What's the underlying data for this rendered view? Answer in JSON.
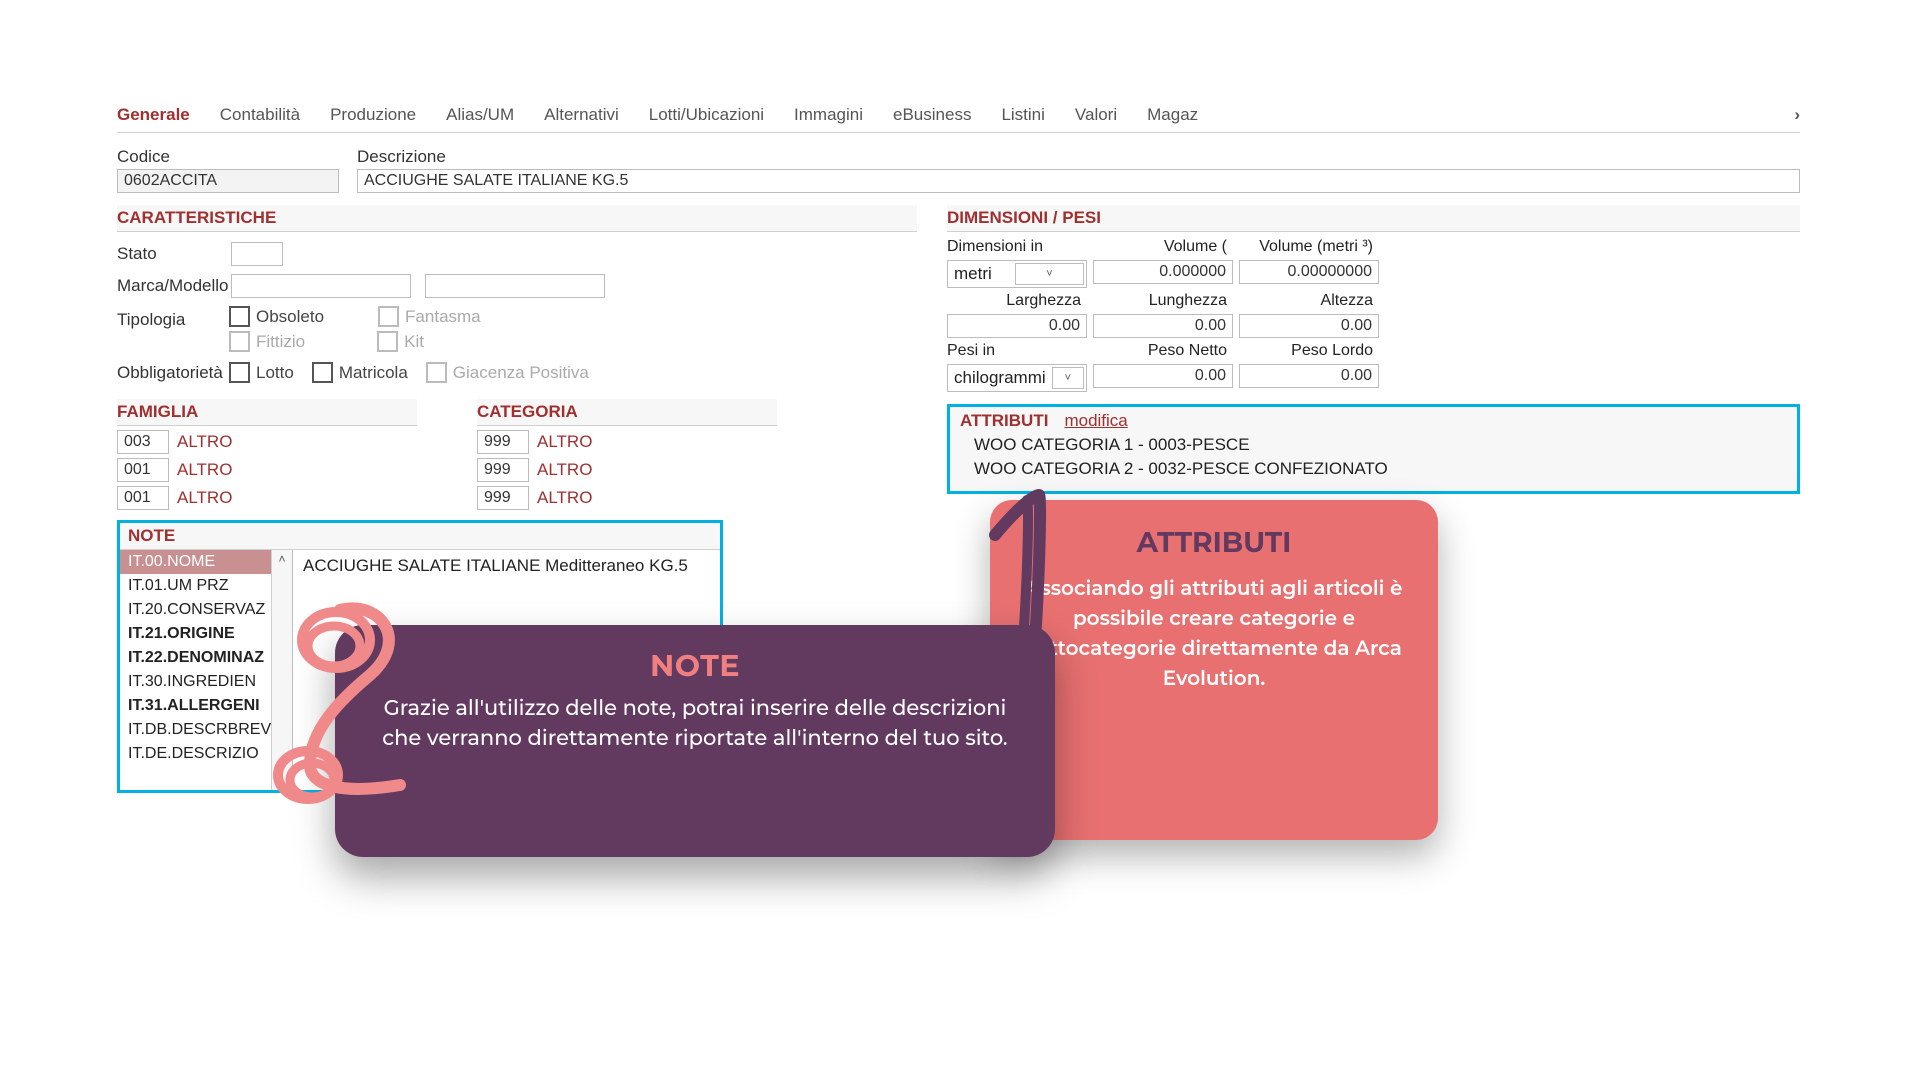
{
  "tabs": {
    "items": [
      "Generale",
      "Contabilità",
      "Produzione",
      "Alias/UM",
      "Alternativi",
      "Lotti/Ubicazioni",
      "Immagini",
      "eBusiness",
      "Listini",
      "Valori",
      "Magaz"
    ],
    "active_index": 0,
    "scroll_glyph": "›"
  },
  "fields": {
    "codice_label": "Codice",
    "codice_value": "0602ACCITA",
    "descrizione_label": "Descrizione",
    "descrizione_value": "ACCIUGHE SALATE ITALIANE KG.5"
  },
  "caratteristiche": {
    "header": "CARATTERISTICHE",
    "stato_label": "Stato",
    "marca_label": "Marca/Modello",
    "tipologia_label": "Tipologia",
    "obbl_label": "Obbligatorietà",
    "obsoleto": "Obsoleto",
    "fittizio": "Fittizio",
    "fantasma": "Fantasma",
    "kit": "Kit",
    "lotto": "Lotto",
    "matricola": "Matricola",
    "giacenza": "Giacenza Positiva"
  },
  "dim": {
    "header": "DIMENSIONI / PESI",
    "dimensioni_in": "Dimensioni in",
    "dimensioni_val": "metri",
    "volume_short": "Volume (",
    "volume_m3": "Volume (metri ³)",
    "vol1": "0.000000",
    "vol2": "0.00000000",
    "larghezza": "Larghezza",
    "lunghezza": "Lunghezza",
    "altezza": "Altezza",
    "zero": "0.00",
    "pesi_in": "Pesi in",
    "pesi_val": "chilogrammi",
    "peso_netto": "Peso Netto",
    "peso_lordo": "Peso Lordo"
  },
  "attr": {
    "header": "ATTRIBUTI",
    "modifica": "modifica",
    "rows": [
      "WOO CATEGORIA 1 - 0003-PESCE",
      "WOO CATEGORIA 2 - 0032-PESCE CONFEZIONATO"
    ]
  },
  "famiglia": {
    "header": "FAMIGLIA",
    "rows": [
      {
        "code": "003",
        "label": "ALTRO"
      },
      {
        "code": "001",
        "label": "ALTRO"
      },
      {
        "code": "001",
        "label": "ALTRO"
      }
    ]
  },
  "categoria": {
    "header": "CATEGORIA",
    "rows": [
      {
        "code": "999",
        "label": "ALTRO"
      },
      {
        "code": "999",
        "label": "ALTRO"
      },
      {
        "code": "999",
        "label": "ALTRO"
      }
    ]
  },
  "note": {
    "header": "NOTE",
    "items": [
      {
        "t": "IT.00.NOME",
        "sel": true
      },
      {
        "t": "IT.01.UM PRZ"
      },
      {
        "t": "IT.20.CONSERVAZ"
      },
      {
        "t": "IT.21.ORIGINE",
        "bold": true
      },
      {
        "t": "IT.22.DENOMINAZ",
        "bold": true
      },
      {
        "t": "IT.30.INGREDIEN"
      },
      {
        "t": "IT.31.ALLERGENI",
        "bold": true
      },
      {
        "t": "IT.DB.DESCRBREV"
      },
      {
        "t": "IT.DE.DESCRIZIO"
      }
    ],
    "preview": "ACCIUGHE SALATE ITALIANE Meditteraneo KG.5"
  },
  "callout_note": {
    "title": "NOTE",
    "body": "Grazie all'utilizzo delle note, potrai inserire delle descrizioni che verranno direttamente riportate  all'interno del tuo sito."
  },
  "callout_attr": {
    "title": "ATTRIBUTI",
    "body": "Associando gli attributi agli articoli è possibile creare categorie e sottocategorie direttamente da Arca Evolution."
  }
}
